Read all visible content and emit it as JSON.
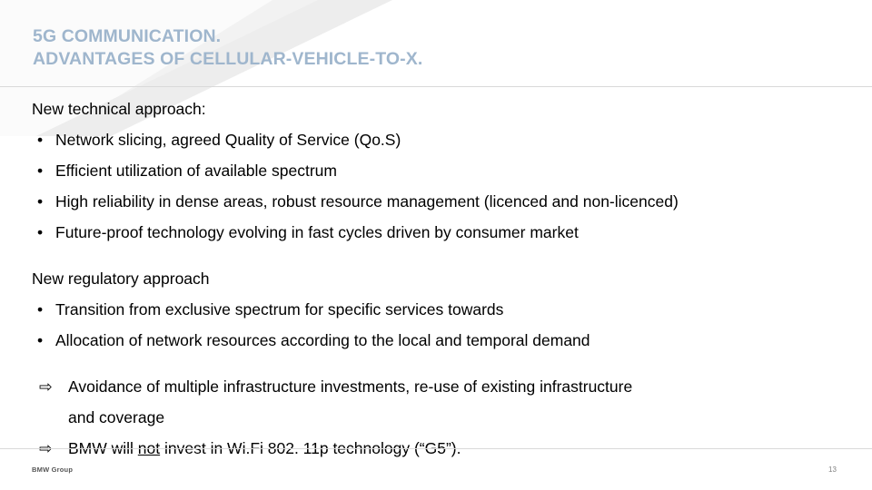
{
  "slide": {
    "title_line1": "5G COMMUNICATION.",
    "title_line2": "ADVANTAGES OF CELLULAR-VEHICLE-TO-X.",
    "section1_heading": "New technical approach:",
    "section1_bullets": [
      "Network slicing, agreed Quality of Service (Qo.S)",
      "Efficient utilization of available spectrum",
      "High reliability in dense areas, robust resource management (licenced and non-licenced)",
      "Future-proof technology evolving in fast cycles driven by consumer market"
    ],
    "section2_heading": "New regulatory approach",
    "section2_bullets": [
      "Transition from exclusive spectrum for specific services towards",
      "Allocation of network resources according to the local and temporal demand"
    ],
    "conclusions": [
      {
        "text_line1": "Avoidance of multiple infrastructure investments, re-use of existing infrastructure",
        "text_line2": "and coverage"
      }
    ],
    "final_statement": {
      "prefix": "BMW will ",
      "emphasis": "not",
      "suffix": " invest in Wi.Fi 802. 11p technology (“G5”)."
    },
    "bullet_glyph": "•",
    "arrow_glyph": "⇨",
    "footer_logo": "BMW Group",
    "page_number": "13",
    "colors": {
      "title": "#9fb6cd",
      "body": "#000000",
      "rule": "#d9d9d9",
      "deco": "#eeeeee"
    }
  }
}
